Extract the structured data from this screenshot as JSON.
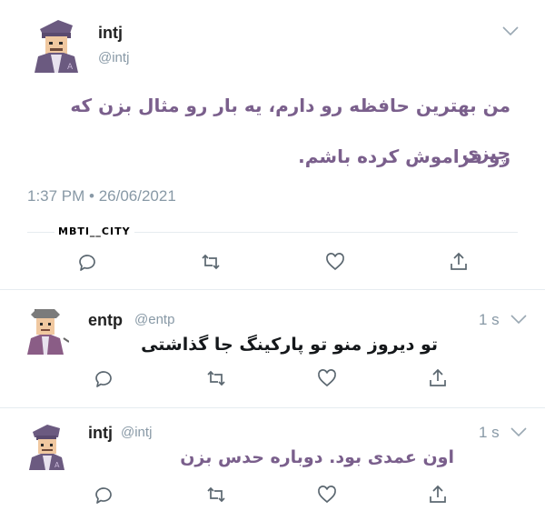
{
  "main_tweet": {
    "name": "intj",
    "handle": "@intj",
    "text_line1": "من بهترین حافظه رو دارم، یه بار رو مثال بزن که چیزی",
    "text_line2": "رو فراموش کرده باشم.",
    "timestamp": "1:37 PM • 26/06/2021",
    "watermark": "MBTI__CITY"
  },
  "replies": [
    {
      "name": "entp",
      "handle": "@entp",
      "time": "1 s",
      "text": "تو دیروز منو تو پارکینگ جا گذاشتی"
    },
    {
      "name": "intj",
      "handle": "@intj",
      "time": "1 s",
      "text": "اون عمدی بود. دوباره حدس بزن"
    }
  ],
  "icons": {
    "reply": "reply-icon",
    "retweet": "retweet-icon",
    "like": "like-icon",
    "share": "share-icon",
    "more": "chevron-down-icon"
  },
  "colors": {
    "accent_text": "#7a5f8c",
    "muted": "#8899a6",
    "divider": "#e6ecf0"
  }
}
